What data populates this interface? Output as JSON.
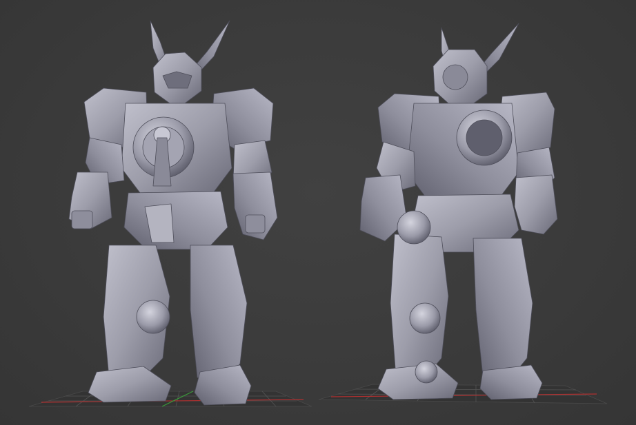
{
  "viewport": {
    "background_color": "#3b3b3b",
    "model_color": "#9a9aa8",
    "model_highlight": "#c4c4d0",
    "model_shadow": "#5d5d6b",
    "grid_color": "#555555",
    "axis_x_color": "#b03030",
    "axis_y_color": "#3a9a3a"
  },
  "models": [
    {
      "name": "robot-front-view",
      "view": "front"
    },
    {
      "name": "robot-back-three-quarter-view",
      "view": "back"
    }
  ]
}
